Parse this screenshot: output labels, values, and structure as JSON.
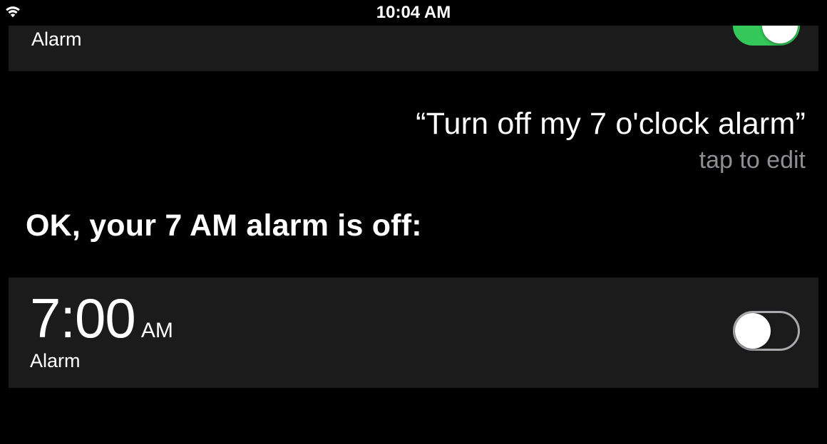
{
  "statusbar": {
    "time": "10:04 AM"
  },
  "previous_alarm_card": {
    "label": "Alarm",
    "toggle_on": true
  },
  "query": {
    "text": "“Turn off my 7 o'clock alarm”",
    "hint": "tap to edit"
  },
  "response": {
    "text": "OK, your 7 AM alarm is off:"
  },
  "alarm_card": {
    "time": "7:00",
    "ampm": "AM",
    "label": "Alarm",
    "toggle_on": false
  }
}
